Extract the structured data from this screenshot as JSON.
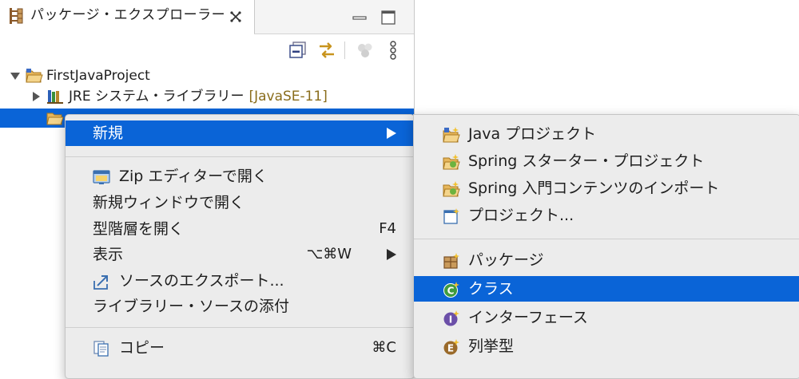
{
  "view": {
    "title": "パッケージ・エクスプローラー"
  },
  "tree": {
    "project": "FirstJavaProject",
    "jre": {
      "label": "JRE システム・ライブラリー",
      "decoration": "[JavaSE-11]"
    }
  },
  "context_menu": {
    "items": [
      {
        "label": "新規",
        "submenu": true,
        "highlighted": true
      },
      {
        "label": "Zip エディターで開く",
        "icon": "zip-editor-icon"
      },
      {
        "label": "新規ウィンドウで開く"
      },
      {
        "label": "型階層を開く",
        "shortcut": "F4"
      },
      {
        "label": "表示",
        "shortcut": "⌥⌘W",
        "submenu": true
      },
      {
        "label": "ソースのエクスポート...",
        "icon": "export-icon"
      },
      {
        "label": "ライブラリー・ソースの添付"
      },
      {
        "label": "コピー",
        "shortcut": "⌘C",
        "icon": "copy-icon"
      }
    ]
  },
  "submenu": {
    "items": [
      {
        "label": "Java プロジェクト",
        "icon": "java-project-icon"
      },
      {
        "label": "Spring スターター・プロジェクト",
        "icon": "spring-starter-icon"
      },
      {
        "label": "Spring 入門コンテンツのインポート",
        "icon": "spring-import-icon"
      },
      {
        "label": "プロジェクト...",
        "icon": "project-icon"
      },
      {
        "label": "パッケージ",
        "icon": "package-icon"
      },
      {
        "label": "クラス",
        "icon": "class-icon",
        "highlighted": true
      },
      {
        "label": "インターフェース",
        "icon": "interface-icon"
      },
      {
        "label": "列挙型",
        "icon": "enum-icon"
      }
    ]
  },
  "colors": {
    "selection": "#0a64d7",
    "menu_bg": "#ececec",
    "decoration": "#8a6d1c"
  }
}
